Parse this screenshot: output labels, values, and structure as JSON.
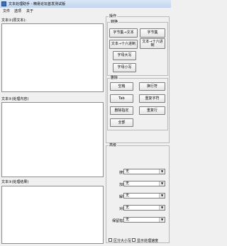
{
  "window": {
    "title": "文本处理助手 - 精易论坛首发测试版"
  },
  "menu": [
    "文件",
    "选项",
    "关于"
  ],
  "panels": {
    "source_label": "文本①(原文本):",
    "process_label": "文本②(处理内容)",
    "result_label": "文本③(处理结果)"
  },
  "operations": {
    "title": "操作",
    "convert": {
      "title": "转换",
      "buttons": [
        "字节集→文本",
        "字节集",
        "文本→十六进制",
        "文本→十六进制",
        "字母大写",
        "字母小写"
      ]
    },
    "delete": {
      "title": "删除",
      "buttons": [
        "空格",
        "换行符",
        "Tab",
        "重复字符",
        "删除指定",
        "重复行",
        "全部"
      ]
    }
  },
  "advanced": {
    "title": "高级",
    "fields": [
      {
        "label": "搜索",
        "value": "无"
      },
      {
        "label": "加密",
        "value": "无"
      },
      {
        "label": "解密",
        "value": "无"
      },
      {
        "label": "对比",
        "value": "无"
      },
      {
        "label": "保留指定",
        "value": "无"
      }
    ]
  },
  "options": {
    "case_sensitive": "区分大小写",
    "show_speed": "显示处理速度"
  }
}
